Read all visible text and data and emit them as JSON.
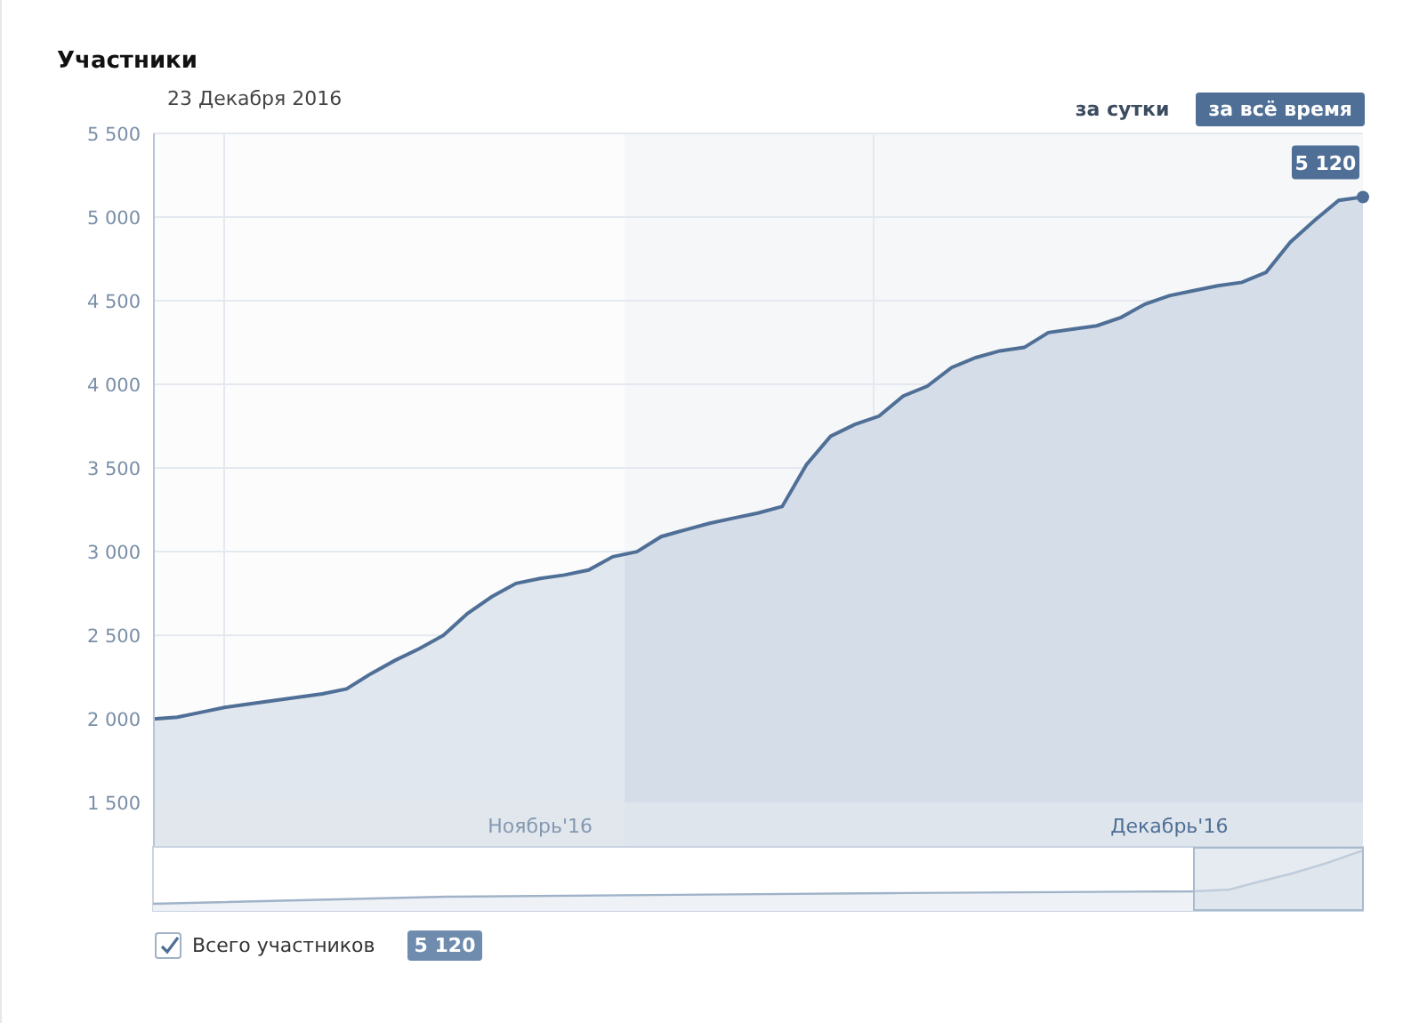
{
  "title": "Участники",
  "date": "23 Декабря 2016",
  "periods": [
    {
      "label": "за сутки",
      "selected": false
    },
    {
      "label": "за всё время",
      "selected": true
    }
  ],
  "chart_data": {
    "type": "area",
    "categories": [
      null,
      null,
      null,
      null,
      null,
      null,
      null,
      null,
      null,
      null,
      null,
      null,
      null,
      null,
      null,
      null,
      "Ноябрь'16",
      null,
      null,
      null,
      null,
      null,
      null,
      null,
      null,
      null,
      null,
      null,
      null,
      null,
      null,
      null,
      null,
      null,
      null,
      null,
      null,
      null,
      null,
      null,
      null,
      null,
      "Декабрь'16",
      null,
      null,
      null,
      null,
      null,
      null,
      null,
      null
    ],
    "series": [
      {
        "name": "Всего участников",
        "color": "#4f6f97",
        "values": [
          2000,
          2010,
          2040,
          2070,
          2090,
          2110,
          2130,
          2150,
          2180,
          2270,
          2350,
          2420,
          2500,
          2630,
          2730,
          2810,
          2840,
          2860,
          2890,
          2970,
          3000,
          3090,
          3130,
          3170,
          3200,
          3230,
          3270,
          3520,
          3690,
          3760,
          3810,
          3930,
          3990,
          4100,
          4160,
          4200,
          4220,
          4310,
          4330,
          4350,
          4400,
          4480,
          4530,
          4560,
          4590,
          4610,
          4670,
          4850,
          4980,
          5100,
          5120
        ]
      }
    ],
    "ylim": [
      1235,
      5500
    ],
    "yticks": [
      {
        "value": 1500,
        "label": "1 500"
      },
      {
        "value": 2000,
        "label": "2 000"
      },
      {
        "value": 2500,
        "label": "2 500"
      },
      {
        "value": 3000,
        "label": "3 000"
      },
      {
        "value": 3500,
        "label": "3 500"
      },
      {
        "value": 4000,
        "label": "4 000"
      },
      {
        "value": 4500,
        "label": "4 500"
      },
      {
        "value": 5000,
        "label": "5 000"
      },
      {
        "value": 5500,
        "label": "5 500"
      }
    ],
    "grid": true,
    "annotations": [
      "5 120"
    ]
  },
  "legend": {
    "checked": true,
    "value": "5 120"
  }
}
